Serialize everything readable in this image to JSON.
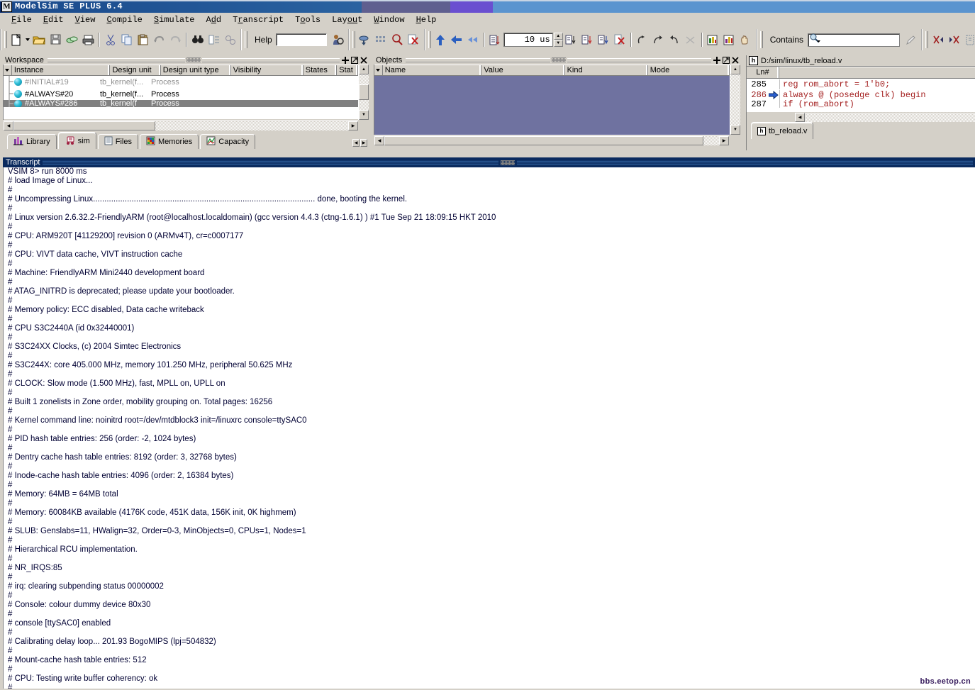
{
  "window": {
    "title": "ModelSim SE PLUS 6.4",
    "logo_glyph": "M"
  },
  "menubar": {
    "items": [
      {
        "label": "File"
      },
      {
        "label": "Edit"
      },
      {
        "label": "View"
      },
      {
        "label": "Compile"
      },
      {
        "label": "Simulate"
      },
      {
        "label": "Add"
      },
      {
        "label": "Transcript"
      },
      {
        "label": "Tools"
      },
      {
        "label": "Layout"
      },
      {
        "label": "Window"
      },
      {
        "label": "Help"
      }
    ]
  },
  "toolbar": {
    "standard_icons": [
      "new-document-icon",
      "new-dropdown-arrow-icon",
      "open-folder-icon",
      "save-icon",
      "compile-icon",
      "print-icon",
      "cut-icon",
      "copy-icon",
      "paste-icon",
      "undo-icon",
      "redo-icon",
      "find-binoculars-icon",
      "find-in-files-icon",
      "replace-icon"
    ],
    "help_label": "Help",
    "help_value": "",
    "help_placeholder": "",
    "help_search_icon": "help-search-person-icon",
    "compile_icons": [
      "compile-selected-icon",
      "compile-all-icon",
      "simulate-icon",
      "break-icon"
    ],
    "run_icons": [
      "run-up-icon",
      "run-back-icon",
      "run-continue-icon"
    ],
    "run_length_icon": "run-length-icon",
    "run_length_value": "10 us",
    "step_icons": [
      "run-all-icon",
      "continue-run-icon",
      "step-icon",
      "stop-icon"
    ],
    "step_into_icons": [
      "step-into-icon",
      "step-over-icon",
      "step-out-icon",
      "restart-icon"
    ],
    "wave_icons": [
      "profile-report-icon",
      "memory-report-icon",
      "hand-pan-icon"
    ],
    "contains_label": "Contains",
    "contains_value": "",
    "contains_placeholder": "",
    "contains_icon": "magnifier-dropdown-icon",
    "contains_edit_icon": "pencil-edit-icon",
    "right_icons": [
      "collapse-all-icon",
      "expand-all-icon",
      "copy-signal-icon",
      "paste-signal-icon",
      "delete-wave-icon"
    ]
  },
  "workspace": {
    "title": "Workspace",
    "header_buttons": [
      "dock-icon",
      "undock-icon",
      "close-icon"
    ],
    "columns": [
      "Instance",
      "Design unit",
      "Design unit type",
      "Visibility",
      "States",
      "Stat"
    ],
    "rows": [
      {
        "instance": "#INITIAL#19",
        "design_unit": "tb_kernel(f...",
        "design_unit_type": "Process",
        "visibility": "",
        "states": "",
        "stat": "",
        "style": "dim"
      },
      {
        "instance": "#ALWAYS#20",
        "design_unit": "tb_kernel(f...",
        "design_unit_type": "Process",
        "visibility": "",
        "states": "",
        "stat": "",
        "style": "normal"
      },
      {
        "instance": "#ALWAYS#286",
        "design_unit": "tb_kernel(f",
        "design_unit_type": "Process",
        "visibility": "",
        "states": "",
        "stat": "",
        "style": "selected"
      }
    ],
    "tabs": [
      {
        "label": "Library",
        "icon": "library-bars-icon",
        "active": false
      },
      {
        "label": "sim",
        "icon": "sim-cart-icon",
        "active": true
      },
      {
        "label": "Files",
        "icon": "files-document-icon",
        "active": false
      },
      {
        "label": "Memories",
        "icon": "memories-grid-icon",
        "active": false
      },
      {
        "label": "Capacity",
        "icon": "capacity-chart-icon",
        "active": false
      }
    ]
  },
  "objects": {
    "title": "Objects",
    "header_buttons": [
      "dock-icon",
      "undock-icon",
      "close-icon"
    ],
    "columns": [
      "Name",
      "Value",
      "Kind",
      "Mode"
    ],
    "rows": [],
    "empty_bg_color": "#6f72a0"
  },
  "source": {
    "file_path": "D:/sim/linux/tb_reload.v",
    "file_icon": "verilog-h-file-icon",
    "ln_header": "Ln#",
    "lines": [
      {
        "num": "285",
        "code": "reg rom_abort = 1'b0;",
        "current": false
      },
      {
        "num": "286",
        "code": "always @ (posedge clk) begin",
        "current": true
      },
      {
        "num": "287",
        "code": "if (rom_abort)",
        "current": false
      }
    ],
    "current_line_arrow_icon": "execution-arrow-icon",
    "tab": {
      "label": "tb_reload.v",
      "icon": "verilog-h-file-icon"
    }
  },
  "transcript": {
    "title": "Transcript",
    "lines": [
      "VSIM 8> run 8000 ms",
      "# load Image of Linux...",
      "#",
      "# Uncompressing Linux.................................................................................................. done, booting the kernel.",
      "#",
      "# Linux version 2.6.32.2-FriendlyARM (root@localhost.localdomain) (gcc version 4.4.3 (ctng-1.6.1) ) #1 Tue Sep 21 18:09:15 HKT 2010",
      "#",
      "# CPU: ARM920T [41129200] revision 0 (ARMv4T), cr=c0007177",
      "#",
      "# CPU: VIVT data cache, VIVT instruction cache",
      "#",
      "# Machine: FriendlyARM Mini2440 development board",
      "#",
      "# ATAG_INITRD is deprecated; please update your bootloader.",
      "#",
      "# Memory policy: ECC disabled, Data cache writeback",
      "#",
      "# CPU S3C2440A (id 0x32440001)",
      "#",
      "# S3C24XX Clocks, (c) 2004 Simtec Electronics",
      "#",
      "# S3C244X: core 405.000 MHz, memory 101.250 MHz, peripheral 50.625 MHz",
      "#",
      "# CLOCK: Slow mode (1.500 MHz), fast, MPLL on, UPLL on",
      "#",
      "# Built 1 zonelists in Zone order, mobility grouping on.  Total pages: 16256",
      "#",
      "# Kernel command line: noinitrd root=/dev/mtdblock3 init=/linuxrc console=ttySAC0",
      "#",
      "# PID hash table entries: 256 (order: -2, 1024 bytes)",
      "#",
      "# Dentry cache hash table entries: 8192 (order: 3, 32768 bytes)",
      "#",
      "# Inode-cache hash table entries: 4096 (order: 2, 16384 bytes)",
      "#",
      "# Memory: 64MB = 64MB total",
      "#",
      "# Memory: 60084KB available (4176K code, 451K data, 156K init, 0K highmem)",
      "#",
      "# SLUB: Genslabs=11, HWalign=32, Order=0-3, MinObjects=0, CPUs=1, Nodes=1",
      "#",
      "# Hierarchical RCU implementation.",
      "#",
      "# NR_IRQS:85",
      "#",
      "# irq: clearing subpending status 00000002",
      "#",
      "# Console: colour dummy device 80x30",
      "#",
      "# console [ttySAC0] enabled",
      "#",
      "# Calibrating delay loop... 201.93 BogoMIPS (lpj=504832)",
      "#",
      "# Mount-cache hash table entries: 512",
      "#",
      "# CPU: Testing write buffer coherency: ok",
      "#"
    ]
  },
  "watermark": {
    "text": "bbs.eetop.cn"
  },
  "colors": {
    "titlebar_start": "#0a2a6b",
    "titlebar_end": "#2a62a0",
    "transcript_header": "#0a2a5e",
    "transcript_text": "#000033",
    "objects_empty": "#6f72a0",
    "source_code": "#a42020",
    "chrome": "#d4d0c8",
    "watermark": "#3b2060"
  }
}
